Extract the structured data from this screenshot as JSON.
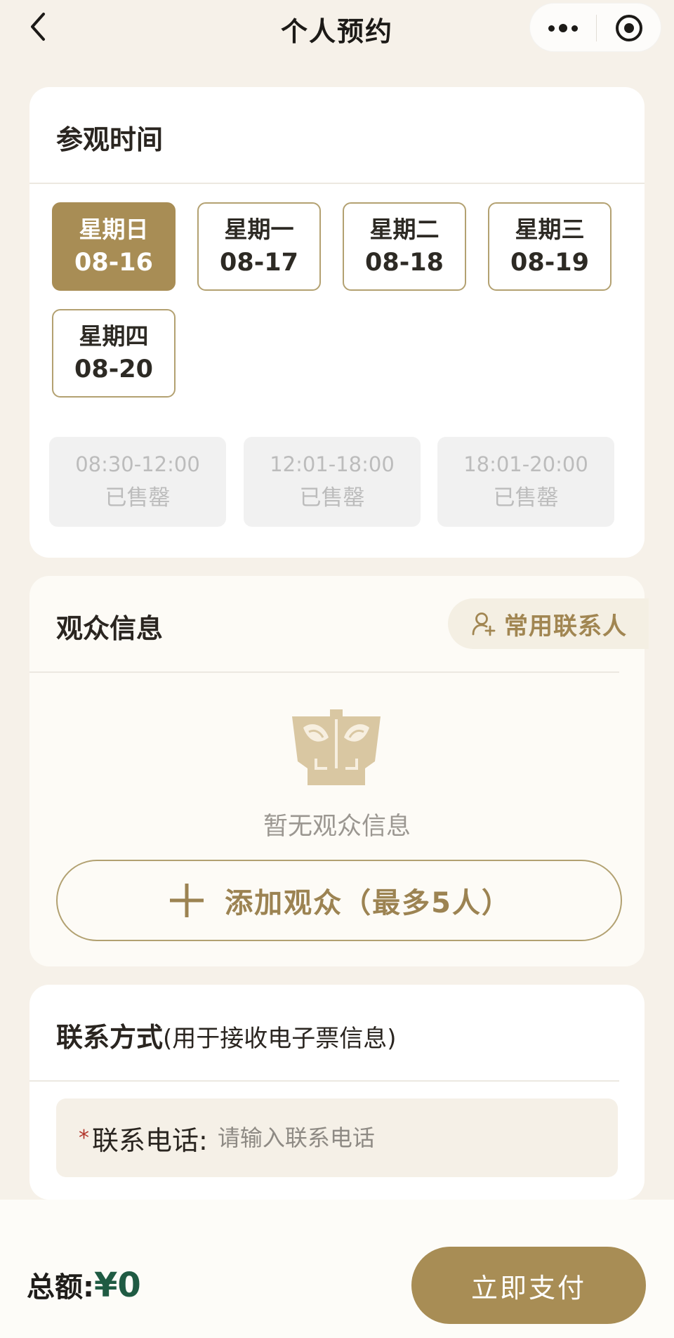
{
  "header": {
    "title": "个人预约",
    "back_icon": "chevron-left-icon",
    "more_icon": "more-dots-icon",
    "close_icon": "target-circle-icon"
  },
  "visit": {
    "title": "参观时间",
    "dates": [
      {
        "weekday": "星期日",
        "date": "08-16",
        "selected": true
      },
      {
        "weekday": "星期一",
        "date": "08-17",
        "selected": false
      },
      {
        "weekday": "星期二",
        "date": "08-18",
        "selected": false
      },
      {
        "weekday": "星期三",
        "date": "08-19",
        "selected": false
      },
      {
        "weekday": "星期四",
        "date": "08-20",
        "selected": false
      }
    ],
    "slots": [
      {
        "time": "08:30-12:00",
        "status": "已售罄"
      },
      {
        "time": "12:01-18:00",
        "status": "已售罄"
      },
      {
        "time": "18:01-20:00",
        "status": "已售罄"
      }
    ]
  },
  "audience": {
    "title": "观众信息",
    "contacts_label": "常用联系人",
    "empty_text": "暂无观众信息",
    "add_label": "添加观众（最多5人）"
  },
  "contact": {
    "title": "联系方式",
    "title_note": "(用于接收电子票信息)",
    "required_mark": "*",
    "phone_label": "联系电话:",
    "phone_placeholder": "请输入联系电话",
    "phone_value": ""
  },
  "footer": {
    "total_label": "总额:",
    "total_amount": "¥0",
    "pay_label": "立即支付"
  },
  "colors": {
    "accent": "#a88d55",
    "border_gold": "#b3a171",
    "amount_green": "#1f5b43",
    "background": "#f6f1e9",
    "disabled_bg": "#f1f1f1"
  }
}
